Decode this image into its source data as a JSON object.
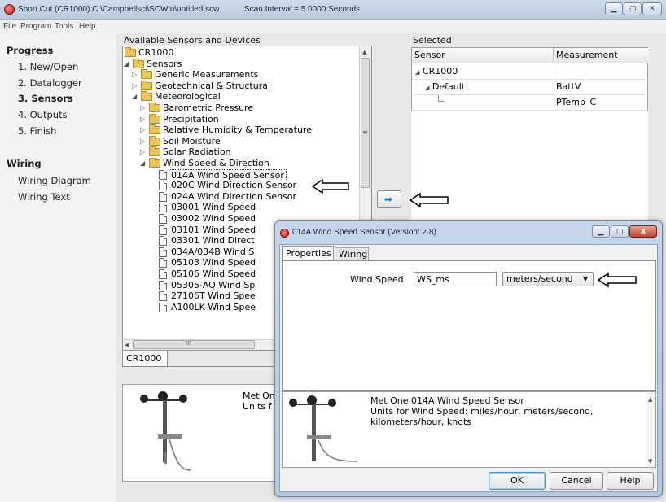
{
  "window": {
    "title": "Short Cut (CR1000) C:\\Campbellsci\\SCWin\\untitled.scw",
    "scan_interval": "Scan Interval = 5.0000 Seconds"
  },
  "menu": [
    "File",
    "Program",
    "Tools",
    "Help"
  ],
  "progress": {
    "heading": "Progress",
    "steps": [
      "1. New/Open",
      "2. Datalogger",
      "3. Sensors",
      "4. Outputs",
      "5. Finish"
    ],
    "active_step": "3. Sensors",
    "wiring_heading": "Wiring",
    "wiring_items": [
      "Wiring Diagram",
      "Wiring Text"
    ]
  },
  "available": {
    "label": "Available Sensors and Devices",
    "tree": [
      {
        "text": "CR1000",
        "icon": "folder-icon",
        "level": 0
      },
      {
        "text": "Sensors",
        "icon": "folder-icon",
        "level": 1,
        "expanded": true
      },
      {
        "text": "Generic Measurements",
        "icon": "folder-icon",
        "level": 2
      },
      {
        "text": "Geotechnical & Structural",
        "icon": "folder-icon",
        "level": 2
      },
      {
        "text": "Meteorological",
        "icon": "folder-icon",
        "level": 2,
        "expanded": true
      },
      {
        "text": "Barometric Pressure",
        "icon": "folder-icon",
        "level": 3
      },
      {
        "text": "Precipitation",
        "icon": "folder-icon",
        "level": 3
      },
      {
        "text": "Relative Humidity & Temperature",
        "icon": "folder-icon",
        "level": 3
      },
      {
        "text": "Soil Moisture",
        "icon": "folder-icon",
        "level": 3
      },
      {
        "text": "Solar Radiation",
        "icon": "folder-icon",
        "level": 3
      },
      {
        "text": "Wind Speed & Direction",
        "icon": "folder-icon",
        "level": 3,
        "expanded": true
      },
      {
        "text": "014A Wind Speed Sensor",
        "icon": "document-icon",
        "level": 4,
        "selected": true
      },
      {
        "text": "020C Wind Direction Sensor",
        "icon": "document-icon",
        "level": 4
      },
      {
        "text": "024A Wind Direction Sensor",
        "icon": "document-icon",
        "level": 4
      },
      {
        "text": "03001 Wind Speed",
        "icon": "document-icon",
        "level": 4
      },
      {
        "text": "03002 Wind Speed",
        "icon": "document-icon",
        "level": 4
      },
      {
        "text": "03101 Wind Speed",
        "icon": "document-icon",
        "level": 4
      },
      {
        "text": "03301 Wind Direct",
        "icon": "document-icon",
        "level": 4
      },
      {
        "text": "034A/034B Wind S",
        "icon": "document-icon",
        "level": 4
      },
      {
        "text": "05103 Wind Speed",
        "icon": "document-icon",
        "level": 4
      },
      {
        "text": "05106 Wind Speed",
        "icon": "document-icon",
        "level": 4
      },
      {
        "text": "05305-AQ Wind Sp",
        "icon": "document-icon",
        "level": 4
      },
      {
        "text": "27106T Wind Spee",
        "icon": "document-icon",
        "level": 4
      },
      {
        "text": "A100LK Wind Spee",
        "icon": "document-icon",
        "level": 4
      }
    ],
    "tab": "CR1000",
    "hscroll_glyph": "III",
    "description_partial": [
      "Met On",
      "Units f"
    ]
  },
  "selected": {
    "label": "Selected",
    "columns": [
      "Sensor",
      "Measurement"
    ],
    "rows": [
      {
        "sensor": "CR1000",
        "measurement": ""
      },
      {
        "sensor": "Default",
        "measurement": "BattV"
      },
      {
        "sensor": "",
        "measurement": "PTemp_C"
      }
    ]
  },
  "add_button_glyph": "➡",
  "dialog": {
    "title": "014A Wind Speed Sensor (Version: 2.8)",
    "close_glyph": "x",
    "tabs": [
      "Properties",
      "Wiring"
    ],
    "field_label": "Wind Speed",
    "field_value": "WS_ms",
    "units_value": "meters/second",
    "description": [
      "Met One 014A Wind Speed Sensor",
      "Units for Wind Speed: miles/hour, meters/second,",
      "kilometers/hour, knots"
    ],
    "buttons": {
      "ok": "OK",
      "cancel": "Cancel",
      "help": "Help"
    }
  },
  "colors": {
    "accent": "#1f6fd1",
    "folder": "#e9c659",
    "title_bar": "#c6d6ea"
  }
}
